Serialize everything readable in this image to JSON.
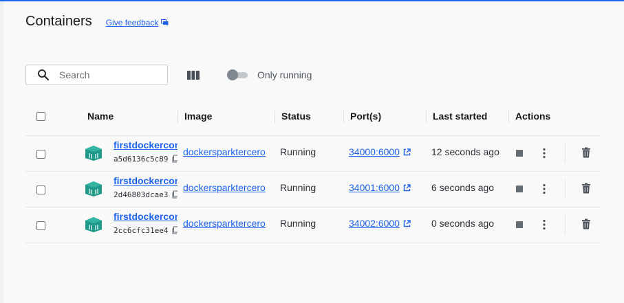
{
  "header": {
    "title": "Containers",
    "feedback_label": "Give feedback"
  },
  "toolbar": {
    "search_placeholder": "Search",
    "only_running_label": "Only running",
    "only_running_enabled": false
  },
  "table": {
    "columns": {
      "name": "Name",
      "image": "Image",
      "status": "Status",
      "ports": "Port(s)",
      "last_started": "Last started",
      "actions": "Actions"
    },
    "rows": [
      {
        "name": "firstdockercontainer",
        "id": "a5d6136c5c89",
        "image": "dockersparktercero",
        "status": "Running",
        "port": "34000:6000",
        "last_started": "12 seconds ago"
      },
      {
        "name": "firstdockercontainer",
        "id": "2d46803dcae3",
        "image": "dockersparktercero",
        "status": "Running",
        "port": "34001:6000",
        "last_started": "6 seconds ago"
      },
      {
        "name": "firstdockercontainer",
        "id": "2cc6cfc31ee4",
        "image": "dockersparktercero",
        "status": "Running",
        "port": "34002:6000",
        "last_started": "0 seconds ago"
      }
    ]
  },
  "colors": {
    "accent": "#1d63ed",
    "container_icon": "#1f9a8a"
  },
  "icons": {
    "search": "search-icon",
    "feedback": "feedback-icon",
    "columns": "columns-icon",
    "container": "container-icon",
    "copy": "copy-icon",
    "external": "external-link-icon",
    "stop": "stop-icon",
    "more": "more-vertical-icon",
    "delete": "trash-icon"
  }
}
